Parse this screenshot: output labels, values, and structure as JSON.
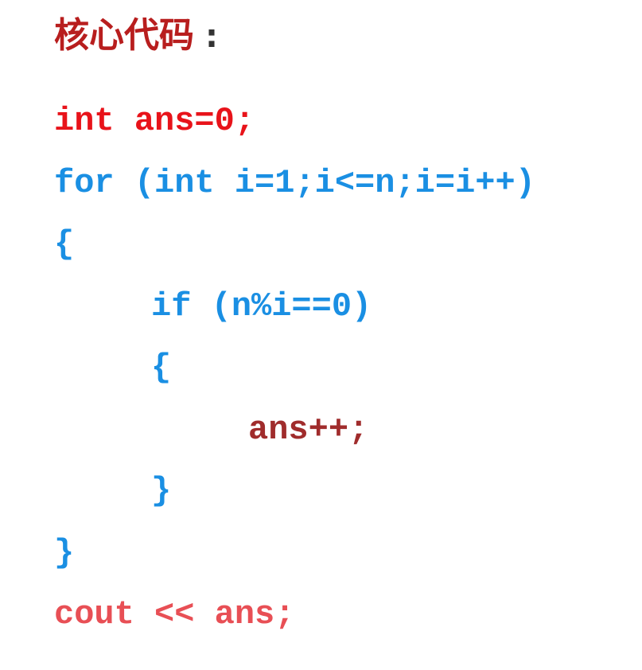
{
  "heading": {
    "title": "核心代码",
    "colon": ":"
  },
  "code": {
    "lines": [
      {
        "text": "int ans=0;",
        "color": "#e8131a",
        "indent": 0
      },
      {
        "text": "for (int i=1;i<=n;i=i++)",
        "color": "#1a8fe3",
        "indent": 0
      },
      {
        "text": "{",
        "color": "#1a8fe3",
        "indent": 0
      },
      {
        "text": "if (n%i==0)",
        "color": "#1a8fe3",
        "indent": 1
      },
      {
        "text": "{",
        "color": "#1a8fe3",
        "indent": 1
      },
      {
        "text": "ans++;",
        "color": "#a02c2c",
        "indent": 2
      },
      {
        "text": "}",
        "color": "#1a8fe3",
        "indent": 1
      },
      {
        "text": "}",
        "color": "#1a8fe3",
        "indent": 0
      },
      {
        "text": "cout << ans;",
        "color": "#e84f55",
        "indent": 0
      }
    ]
  },
  "colors": {
    "heading_title": "#b81e1e",
    "heading_colon": "#333333"
  }
}
